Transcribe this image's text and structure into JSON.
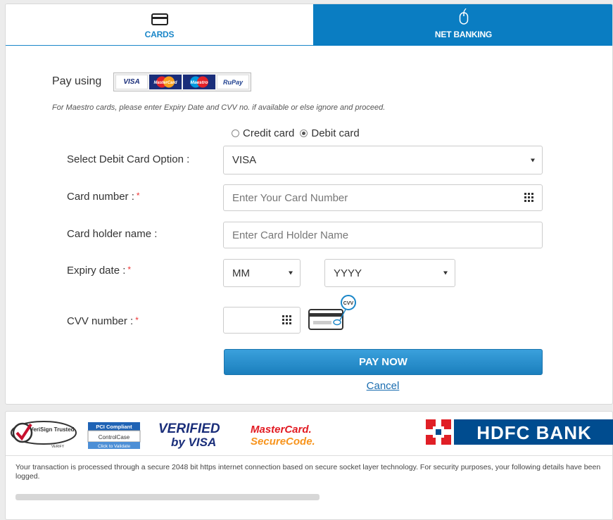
{
  "tabs": {
    "cards_label": "CARDS",
    "netbanking_label": "NET BANKING"
  },
  "pay_using": {
    "label": "Pay using",
    "logos": [
      "VISA",
      "MasterCard",
      "Maestro",
      "RuPay"
    ]
  },
  "note": "For Maestro cards, please enter Expiry Date and CVV no. if available or else ignore and proceed.",
  "card_type": {
    "credit_label": "Credit card",
    "debit_label": "Debit card",
    "selected": "Debit card"
  },
  "form": {
    "option_label": "Select Debit Card Option :",
    "option_value": "VISA",
    "card_number_label": "Card number :",
    "card_number_placeholder": "Enter Your Card Number",
    "holder_label": "Card holder name :",
    "holder_placeholder": "Enter Card Holder Name",
    "expiry_label": "Expiry date :",
    "month_value": "MM",
    "year_value": "YYYY",
    "cvv_label": "CVV number :",
    "cvv_badge": "CVV",
    "required_mark": "*"
  },
  "actions": {
    "pay_label": "PAY NOW",
    "cancel_label": "Cancel"
  },
  "footer": {
    "verisign": "VeriSign Trusted",
    "verisign_sub": "VERIFY",
    "pci_title": "PCI Compliant",
    "pci_brand": "ControlCase",
    "pci_sub": "Click to Validate",
    "verified_visa_1": "VERIFIED",
    "verified_visa_2": "by VISA",
    "mc_secure_1": "MasterCard.",
    "mc_secure_2": "SecureCode.",
    "bank": "HDFC BANK",
    "security_text": "Your transaction is processed through a secure 2048 bit https internet connection based on secure socket layer technology. For security purposes, your following details have been logged."
  },
  "colors": {
    "accent": "#0a7dc2",
    "button": "#1b7fbd",
    "required": "#e33333",
    "hdfc_red": "#e01f26",
    "hdfc_blue": "#004c8f"
  }
}
